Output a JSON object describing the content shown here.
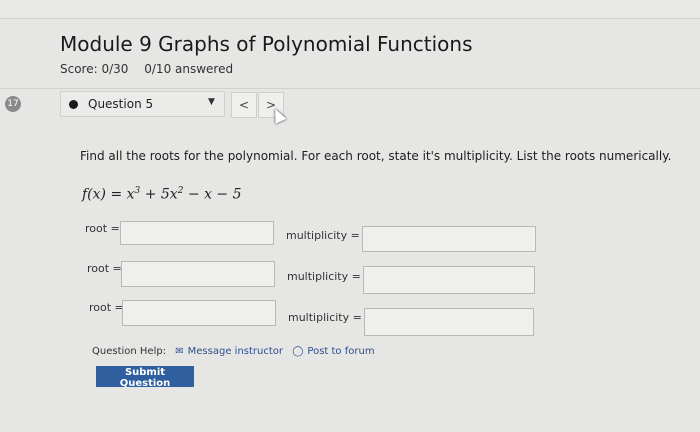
{
  "header": {
    "title": "Module 9 Graphs of Polynomial Functions",
    "score": "Score: 0/30",
    "answered": "0/10 answered"
  },
  "question_nav": {
    "badge": "17",
    "selected": "Question 5",
    "prev_symbol": "<",
    "next_symbol": ">"
  },
  "problem": {
    "prompt": "Find all the roots for the polynomial. For each root, state it's multiplicity. List the roots numerically.",
    "function_lhs": "f(x) = x",
    "exp1": "3",
    "term2": " + 5x",
    "exp2": "2",
    "rest": " − x − 5"
  },
  "answers": {
    "root_label": "root =",
    "multiplicity_label": "multiplicity =",
    "rows": [
      {
        "root": "",
        "multiplicity": ""
      },
      {
        "root": "",
        "multiplicity": ""
      },
      {
        "root": "",
        "multiplicity": ""
      }
    ]
  },
  "help": {
    "label": "Question Help:",
    "message_instructor": "Message instructor",
    "post_forum": "Post to forum",
    "message_icon": "envelope-icon",
    "forum_icon": "speech-bubble-icon"
  },
  "submit": {
    "label": "Submit Question",
    "color": "#2f5f9f"
  }
}
